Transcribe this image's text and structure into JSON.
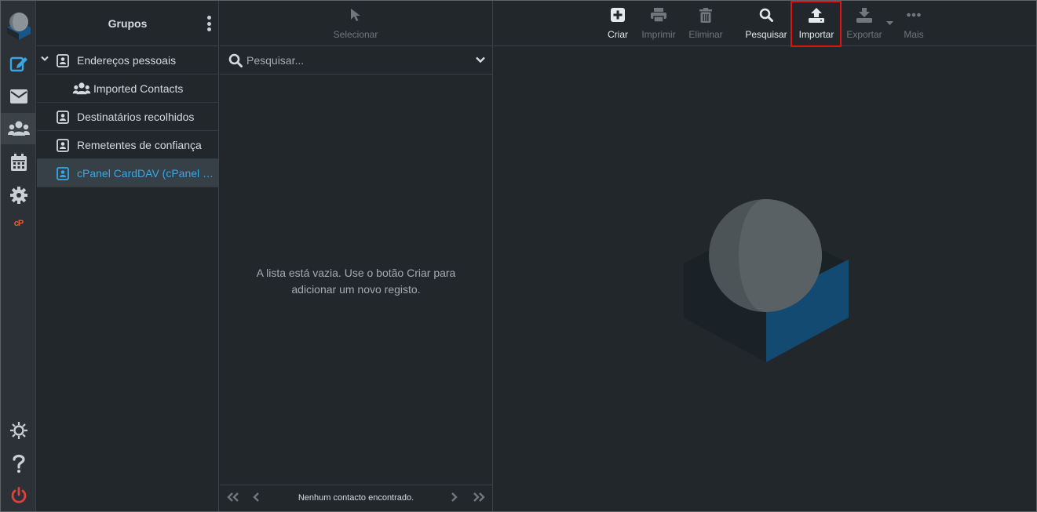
{
  "groups_panel": {
    "title": "Grupos",
    "items": [
      {
        "label": "Endereços pessoais",
        "expanded": true
      },
      {
        "label": "Imported Contacts",
        "sub": true
      },
      {
        "label": "Destinatários recolhidos"
      },
      {
        "label": "Remetentes de confiança"
      },
      {
        "label": "cPanel CardDAV (cPanel CardDAV)",
        "selected": true
      }
    ]
  },
  "list_panel": {
    "select_label": "Selecionar",
    "search_placeholder": "Pesquisar...",
    "empty_message": "A lista está vazia. Use o botão Criar para adicionar um novo registo.",
    "pager_text": "Nenhum contacto encontrado."
  },
  "toolbar": {
    "create": "Criar",
    "print": "Imprimir",
    "delete": "Eliminar",
    "search": "Pesquisar",
    "import": "Importar",
    "export": "Exportar",
    "more": "Mais"
  },
  "sidebar_icons": [
    "logo",
    "compose-icon",
    "mail-icon",
    "contacts-icon",
    "calendar-icon",
    "settings-icon",
    "cpanel-icon",
    "theme-icon",
    "help-icon",
    "logout-icon"
  ],
  "colors": {
    "accent": "#35a8e8",
    "highlight_box": "#e01313",
    "logout": "#e0413a",
    "cpanel": "#e65b32"
  }
}
